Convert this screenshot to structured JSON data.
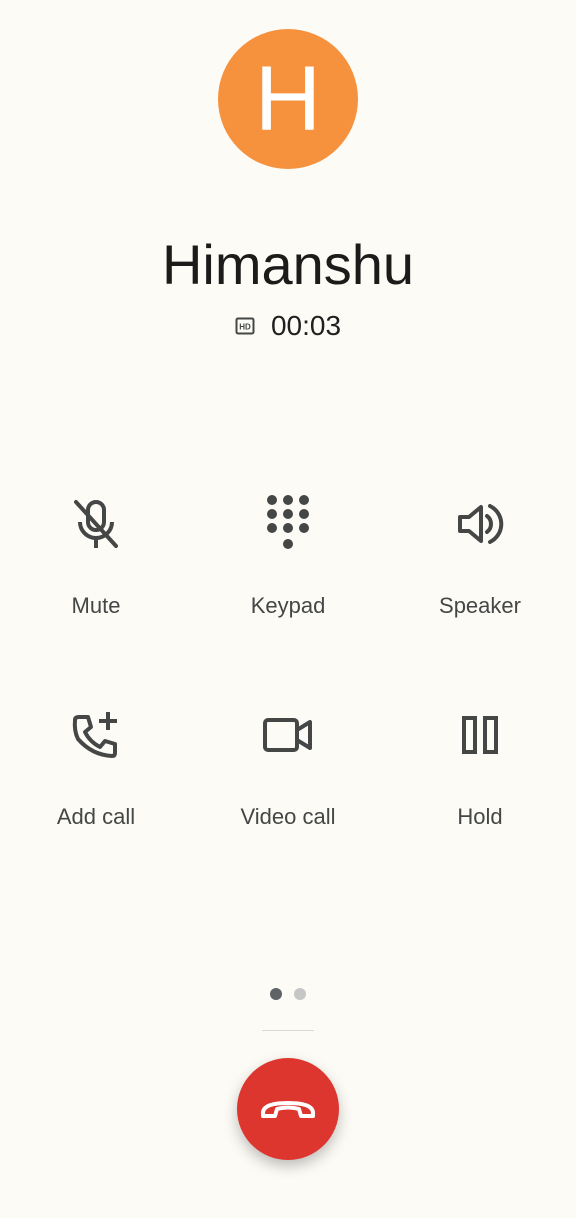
{
  "contact": {
    "avatar_initial": "H",
    "avatar_color": "#f6913d",
    "name": "Himanshu"
  },
  "call": {
    "hd_icon": "hd-icon",
    "timer": "00:03"
  },
  "controls": [
    {
      "label": "Mute",
      "icon": "mic-off-icon"
    },
    {
      "label": "Keypad",
      "icon": "dialpad-icon"
    },
    {
      "label": "Speaker",
      "icon": "speaker-icon"
    },
    {
      "label": "Add call",
      "icon": "add-call-icon"
    },
    {
      "label": "Video call",
      "icon": "videocam-icon"
    },
    {
      "label": "Hold",
      "icon": "pause-icon"
    }
  ],
  "pager": {
    "page_count": 2,
    "current_page": 1
  },
  "end_call": {
    "icon": "call-end-icon",
    "color": "#dc362e"
  }
}
